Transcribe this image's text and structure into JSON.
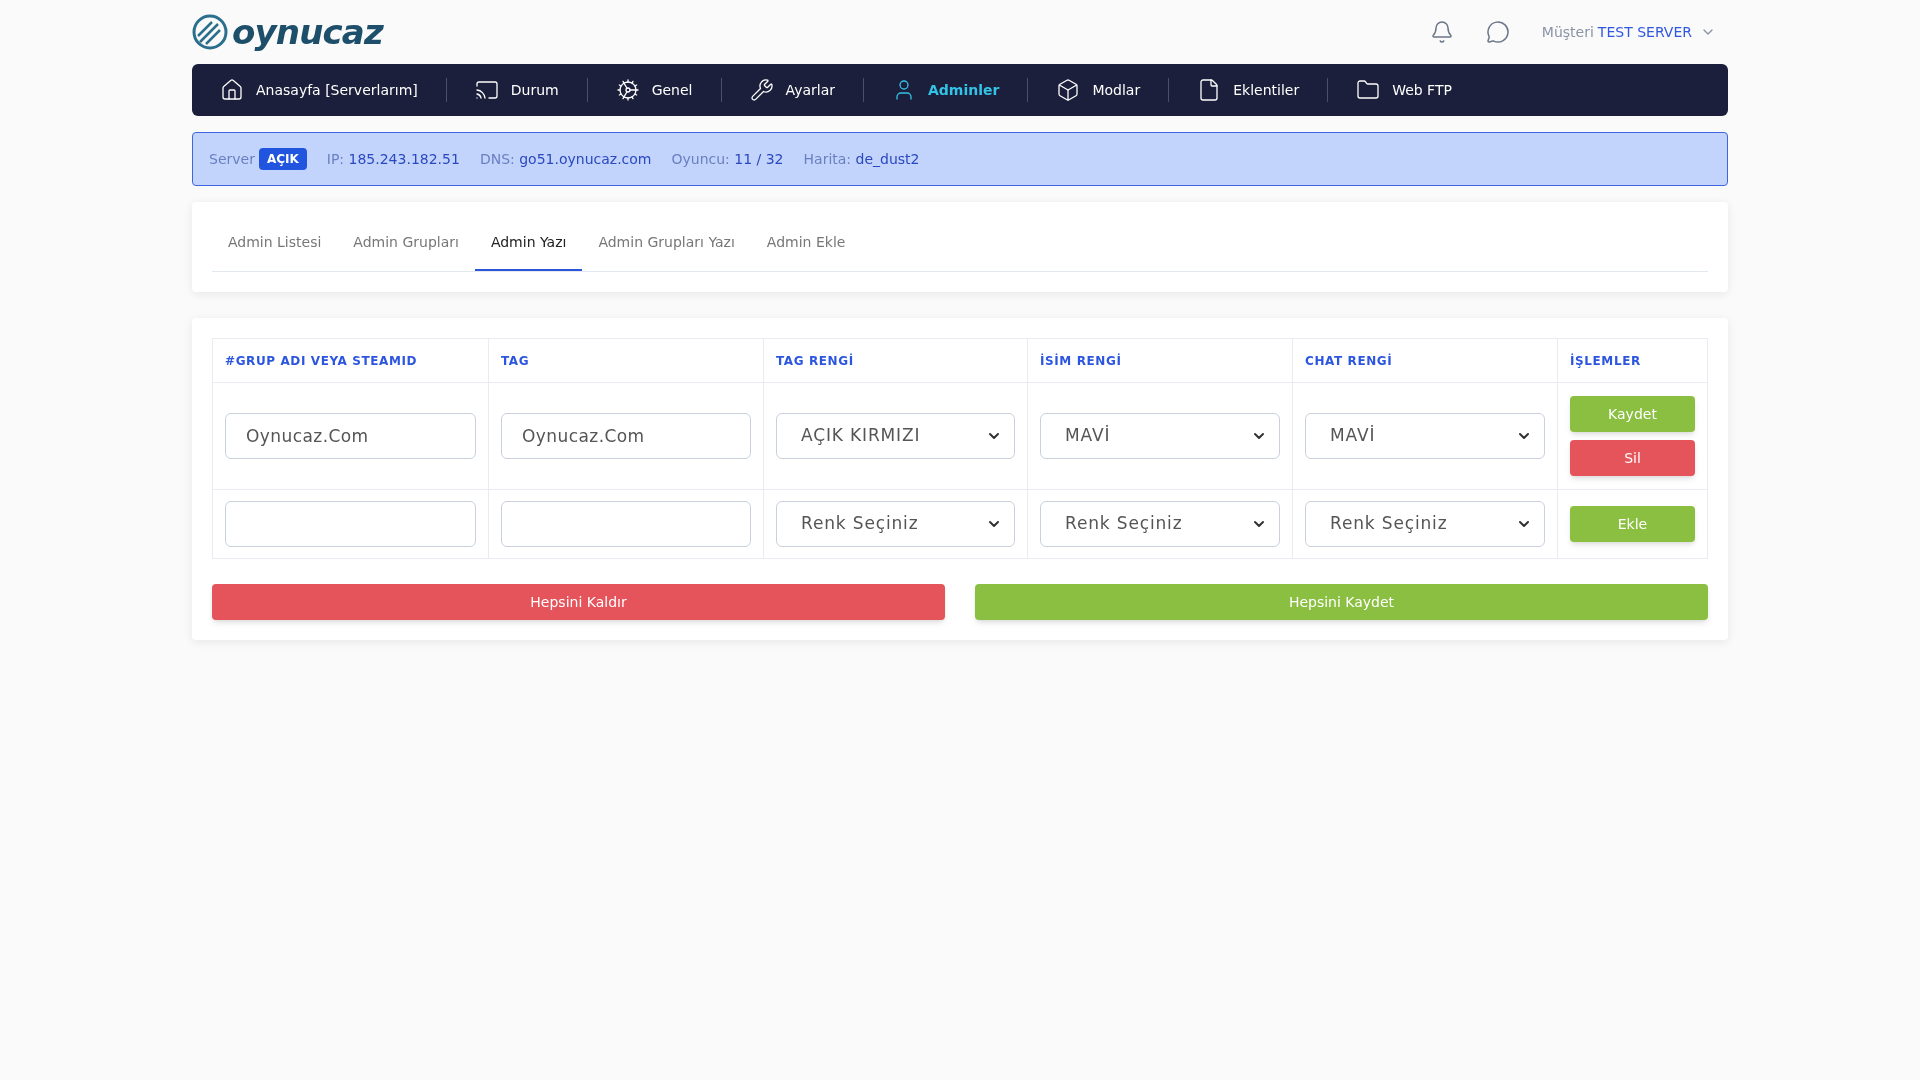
{
  "header": {
    "logo": "oynucaz",
    "user_label": "Müşteri",
    "user_name": "TEST SERVER"
  },
  "nav": [
    {
      "label": "Anasayfa [Serverlarım]",
      "kind": "home",
      "selected": false
    },
    {
      "label": "Durum",
      "kind": "monitor",
      "selected": false
    },
    {
      "label": "Genel",
      "kind": "gear",
      "selected": false
    },
    {
      "label": "Ayarlar",
      "kind": "wrench",
      "selected": false
    },
    {
      "label": "Adminler",
      "kind": "user",
      "selected": true
    },
    {
      "label": "Modlar",
      "kind": "box",
      "selected": false
    },
    {
      "label": "Eklentiler",
      "kind": "file",
      "selected": false
    },
    {
      "label": "Web FTP",
      "kind": "folder",
      "selected": false
    }
  ],
  "server_bar": {
    "server_label": "Server",
    "status": "AÇIK",
    "items": [
      {
        "label": "IP:",
        "value": "185.243.182.51"
      },
      {
        "label": "DNS:",
        "value": "go51.oynucaz.com"
      },
      {
        "label": "Oyuncu:",
        "value": "11 / 32"
      },
      {
        "label": "Harita:",
        "value": "de_dust2"
      }
    ]
  },
  "tabs": [
    {
      "label": "Admin Listesi",
      "selected": false
    },
    {
      "label": "Admin Grupları",
      "selected": false
    },
    {
      "label": "Admin Yazı",
      "selected": true
    },
    {
      "label": "Admin Grupları Yazı",
      "selected": false
    },
    {
      "label": "Admin Ekle",
      "selected": false
    }
  ],
  "table": {
    "columns": [
      "#GRUP ADI VEYA STEAMID",
      "TAG",
      "TAG RENGİ",
      "İSİM RENGİ",
      "CHAT RENGİ",
      "İŞLEMLER"
    ],
    "rows": [
      {
        "name": {
          "value": "Oynucaz.Com"
        },
        "tag": {
          "value": "Oynucaz.Com"
        },
        "tag_color": "AÇIK KIRMIZI",
        "name_color": "MAVİ",
        "chat_color": "MAVİ",
        "actions": [
          {
            "label": "Kaydet",
            "kind": "save"
          },
          {
            "label": "Sil",
            "kind": "delete"
          }
        ]
      },
      {
        "name": {},
        "tag": {},
        "tag_color": "Renk Seçiniz",
        "name_color": "Renk Seçiniz",
        "chat_color": "Renk Seçiniz",
        "actions": [
          {
            "label": "Ekle",
            "kind": "save"
          }
        ]
      }
    ]
  },
  "footer_buttons": [
    {
      "label": "Hepsini Kaldır",
      "kind": "delete"
    },
    {
      "label": "Hepsini Kaydet",
      "kind": "save"
    }
  ]
}
